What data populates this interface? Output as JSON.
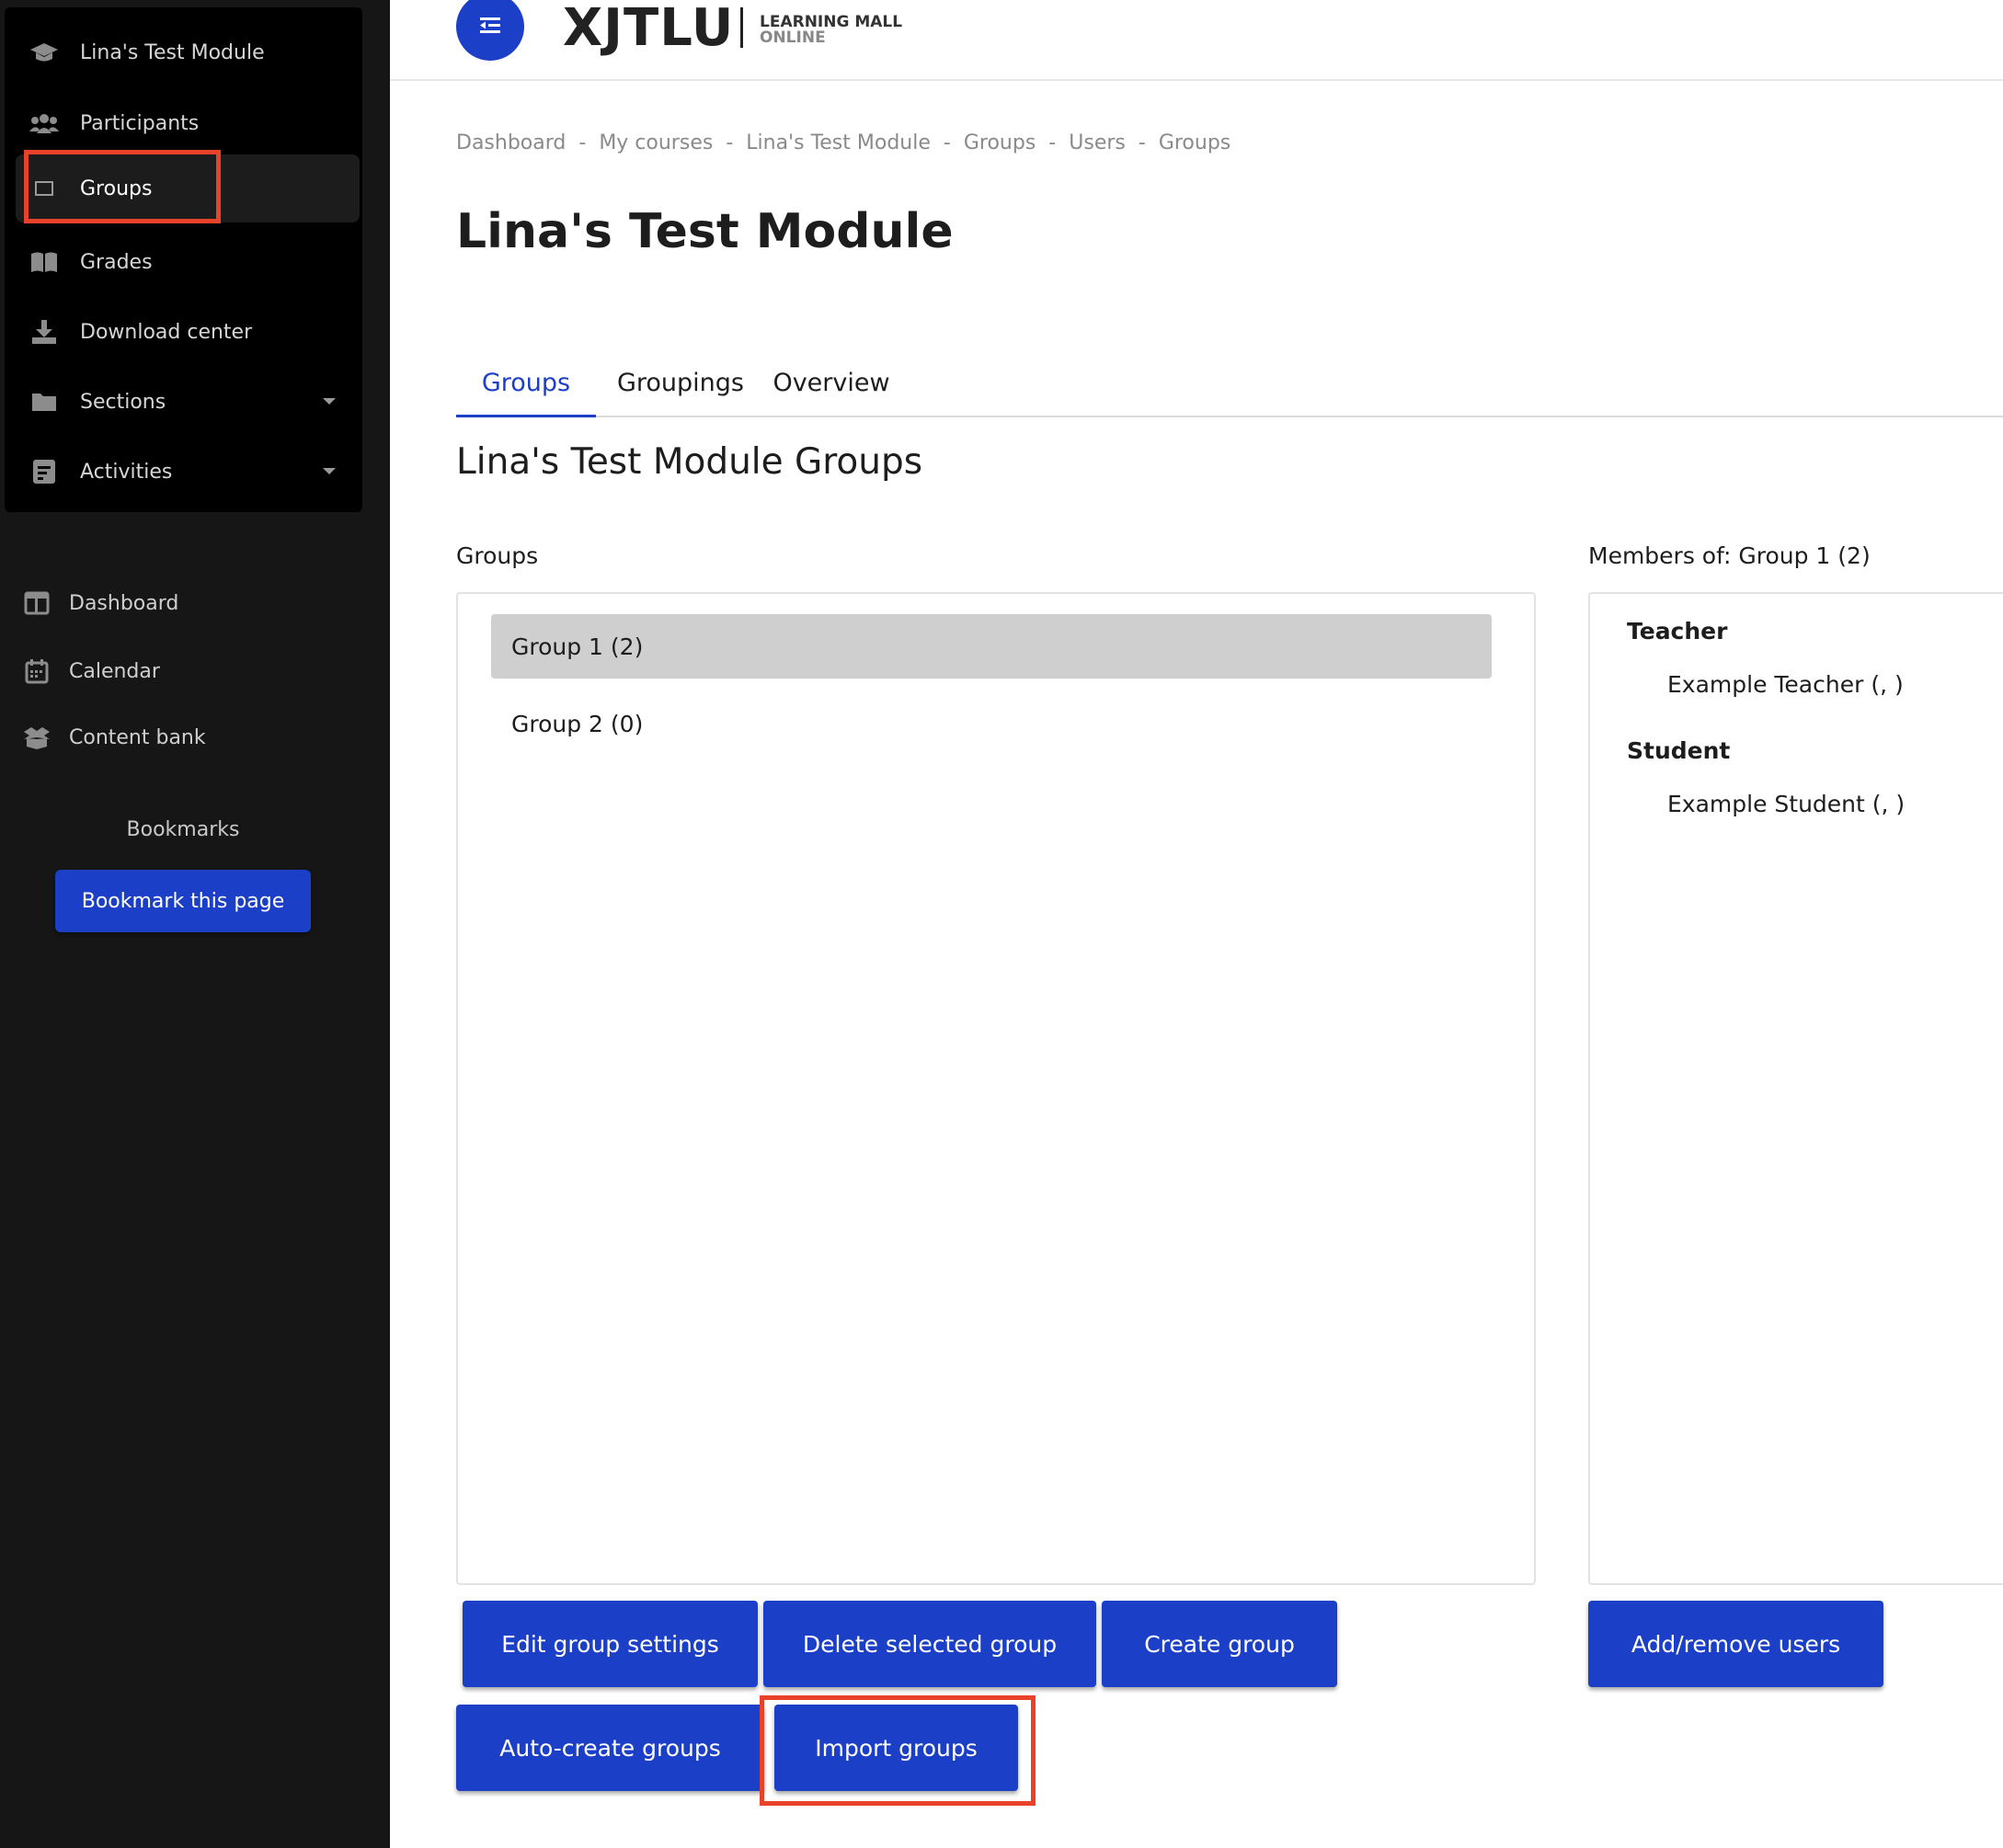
{
  "sidebar": {
    "course_nav": [
      {
        "label": "Lina's Test Module",
        "icon": "graduation-cap-icon"
      },
      {
        "label": "Participants",
        "icon": "users-icon"
      },
      {
        "label": "Groups",
        "icon": "square-icon",
        "active": true
      },
      {
        "label": "Grades",
        "icon": "book-icon"
      },
      {
        "label": "Download center",
        "icon": "download-icon"
      },
      {
        "label": "Sections",
        "icon": "folder-icon",
        "expandable": true
      },
      {
        "label": "Activities",
        "icon": "activity-icon",
        "expandable": true
      }
    ],
    "site_nav": [
      {
        "label": "Dashboard",
        "icon": "dashboard-icon"
      },
      {
        "label": "Calendar",
        "icon": "calendar-icon"
      },
      {
        "label": "Content bank",
        "icon": "box-icon"
      }
    ],
    "bookmarks_title": "Bookmarks",
    "bookmark_button": "Bookmark this page"
  },
  "header": {
    "logo_main": "XJTLU",
    "logo_sub1": "LEARNING MALL",
    "logo_sub2": "ONLINE",
    "menu_icon": "menu-indent-icon"
  },
  "breadcrumb": [
    "Dashboard",
    "My courses",
    "Lina's Test Module",
    "Groups",
    "Users",
    "Groups"
  ],
  "page_title": "Lina's Test Module",
  "tabs": [
    {
      "label": "Groups",
      "active": true
    },
    {
      "label": "Groupings"
    },
    {
      "label": "Overview"
    }
  ],
  "section_title": "Lina's Test Module Groups",
  "groups": {
    "label": "Groups",
    "items": [
      {
        "label": "Group 1 (2)",
        "selected": true
      },
      {
        "label": "Group 2 (0)"
      }
    ]
  },
  "members": {
    "label": "Members of: Group 1 (2)",
    "roles": [
      {
        "role": "Teacher",
        "members": [
          "Example Teacher (, )"
        ]
      },
      {
        "role": "Student",
        "members": [
          "Example Student (, )"
        ]
      }
    ]
  },
  "buttons": {
    "edit": "Edit group settings",
    "delete": "Delete selected group",
    "create": "Create group",
    "auto_create": "Auto-create groups",
    "import": "Import groups",
    "add_remove": "Add/remove users"
  },
  "colors": {
    "accent": "#1b3fc7",
    "highlight": "#e8432a",
    "sidebar_bg": "#161616"
  }
}
